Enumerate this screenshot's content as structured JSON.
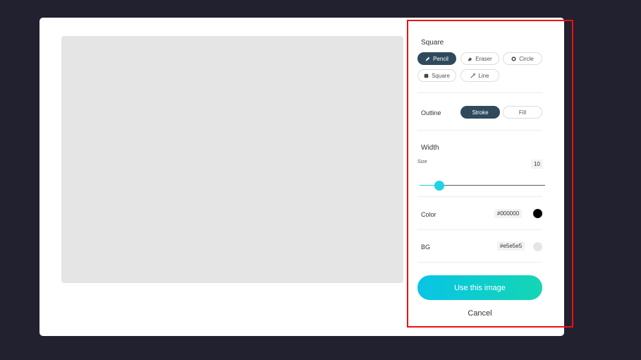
{
  "panel": {
    "shape_section_title": "Square",
    "tools": [
      {
        "label": "Pencil",
        "icon": "pencil-icon",
        "active": true
      },
      {
        "label": "Eraser",
        "icon": "eraser-icon",
        "active": false
      },
      {
        "label": "Circle",
        "icon": "circle-icon",
        "active": false
      },
      {
        "label": "Square",
        "icon": "square-icon",
        "active": false
      },
      {
        "label": "Line",
        "icon": "line-icon",
        "active": false
      }
    ],
    "outline": {
      "label": "Outline",
      "options": [
        {
          "label": "Stroke",
          "active": true
        },
        {
          "label": "Fill",
          "active": false
        }
      ]
    },
    "width": {
      "title": "Width",
      "size_label": "Size",
      "size_value": "10",
      "slider_fraction": 0.13
    },
    "color": {
      "label": "Color",
      "value": "#000000",
      "swatch": "#000000"
    },
    "bg": {
      "label": "BG",
      "value": "#e5e5e5",
      "swatch": "#e5e5e5"
    },
    "use_button": "Use this image",
    "cancel": "Cancel"
  },
  "colors": {
    "accent_dark": "#2f4a5c",
    "accent_gradient_start": "#08c4e6",
    "accent_gradient_end": "#14d6b4",
    "canvas_bg": "#e5e5e5",
    "page_bg": "#22212f",
    "highlight_border": "#ee1111"
  }
}
